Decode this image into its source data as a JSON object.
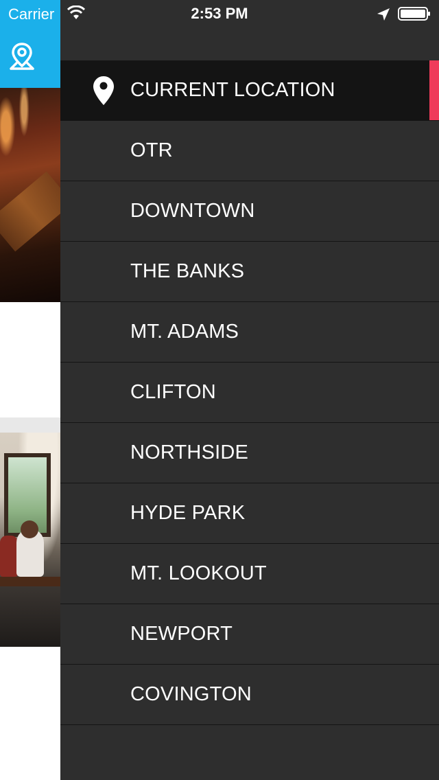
{
  "status_bar": {
    "carrier": "Carrier",
    "time": "2:53 PM",
    "wifi_icon": "wifi-icon",
    "location_icon": "location-arrow-icon",
    "battery_icon": "battery-icon"
  },
  "header_tab": {
    "icon": "map-pin-icon",
    "color": "#1bb0ea"
  },
  "menu": {
    "items": [
      {
        "label": "CURRENT LOCATION",
        "icon": "location-pin-icon",
        "active": true
      },
      {
        "label": "OTR"
      },
      {
        "label": "DOWNTOWN"
      },
      {
        "label": "THE BANKS"
      },
      {
        "label": "MT. ADAMS"
      },
      {
        "label": "CLIFTON"
      },
      {
        "label": "NORTHSIDE"
      },
      {
        "label": "HYDE PARK"
      },
      {
        "label": "MT. LOOKOUT"
      },
      {
        "label": "NEWPORT"
      },
      {
        "label": "COVINGTON"
      }
    ],
    "accent_color": "#ef3b5a",
    "background_color": "#2e2e2e"
  }
}
